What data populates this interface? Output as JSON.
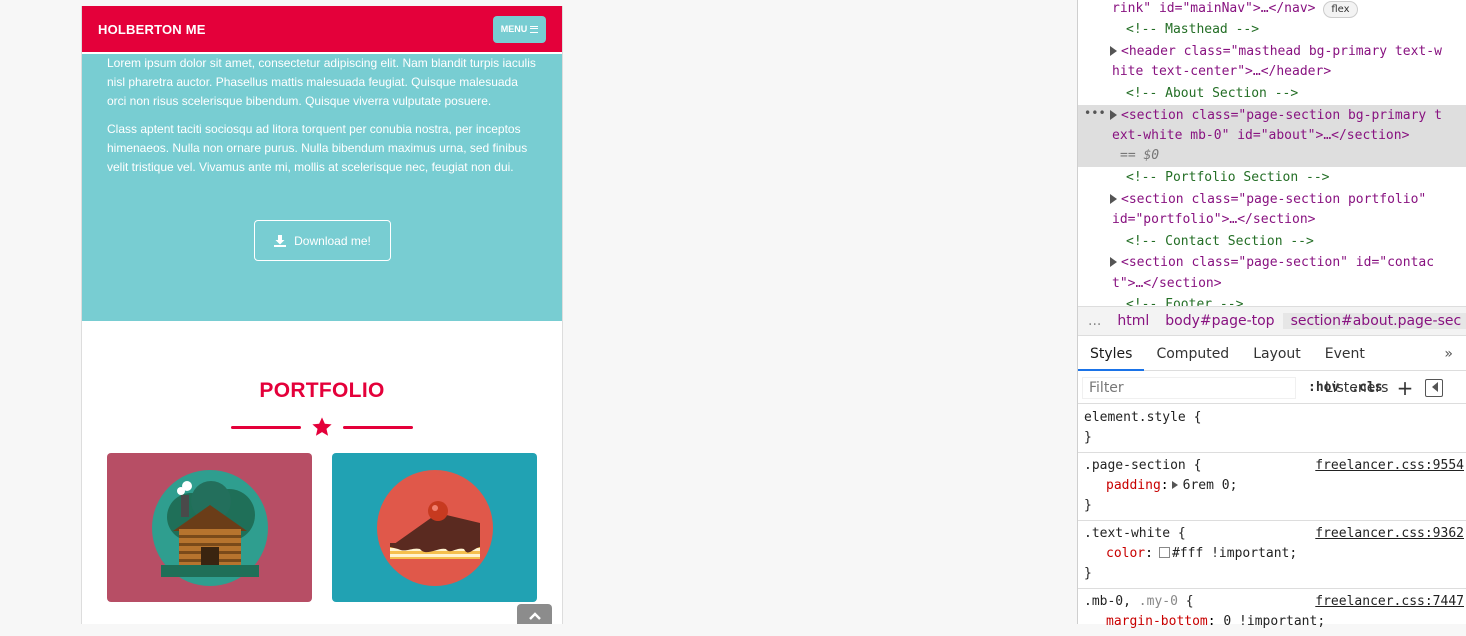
{
  "site": {
    "brand": "HOLBERTON ME",
    "menu_label": "MENU",
    "about": {
      "paragraph_1": "Lorem ipsum dolor sit amet, consectetur adipiscing elit. Nam blandit turpis iaculis nisl pharetra auctor. Phasellus mattis malesuada feugiat. Quisque malesuada orci non risus scelerisque bibendum. Quisque viverra vulputate posuere.",
      "paragraph_2": "Class aptent taciti sociosqu ad litora torquent per conubia nostra, per inceptos himenaeos. Nulla non ornare purus. Nulla bibendum maximus urna, sed finibus velit tristique vel. Vivamus ante mi, mollis at scelerisque nec, feugiat non dui.",
      "download_label": "Download me!"
    },
    "portfolio_title": "PORTFOLIO",
    "colors": {
      "primary": "#e4003a",
      "secondary": "#78cdd2",
      "tile_1": "#b74e65",
      "tile_2": "#21a2b3"
    }
  },
  "devtools": {
    "dom_lines": {
      "l1_text": "rink\" id=\"mainNav\">…</nav>",
      "l1_badge": "flex",
      "c_masthead": "<!-- Masthead -->",
      "header_a": "<header class=\"masthead bg-primary text-w",
      "header_b": "hite text-center\">…</header>",
      "c_about": "<!-- About Section -->",
      "about_a": "<section class=\"page-section bg-primary t",
      "about_b": "ext-white mb-0\" id=\"about\">…</section>",
      "about_eq": "== $0",
      "c_portfolio": "<!-- Portfolio Section -->",
      "portfolio_a": "<section class=\"page-section portfolio\"",
      "portfolio_b": "id=\"portfolio\">…</section>",
      "c_contact": "<!-- Contact Section -->",
      "contact_a": "<section class=\"page-section\" id=\"contac",
      "contact_b": "t\">…</section>",
      "c_footer": "<!-- Footer -->"
    },
    "breadcrumbs": [
      "...",
      "html",
      "body#page-top",
      "section#about.page-sec"
    ],
    "tabs": [
      "Styles",
      "Computed",
      "Layout",
      "Event Listeners"
    ],
    "tabs_more": "»",
    "filter_placeholder": "Filter",
    "hov_label": ":hov",
    "cls_label": ".cls",
    "rules": {
      "r1_selector": "element.style {",
      "r1_close": "}",
      "r2_selector": ".page-section {",
      "r2_source": "freelancer.css:9554",
      "r2_prop": "padding",
      "r2_value": "6rem 0;",
      "r2_close": "}",
      "r3_selector": ".text-white {",
      "r3_source": "freelancer.css:9362",
      "r3_prop": "color",
      "r3_value": "#fff !important;",
      "r3_close": "}",
      "r4_selector_a": ".mb-0,",
      "r4_selector_b": ".my-0",
      "r4_selector_c": "{",
      "r4_source": "freelancer.css:7447",
      "r4_prop": "margin-bottom",
      "r4_value": "0 !important;"
    }
  }
}
